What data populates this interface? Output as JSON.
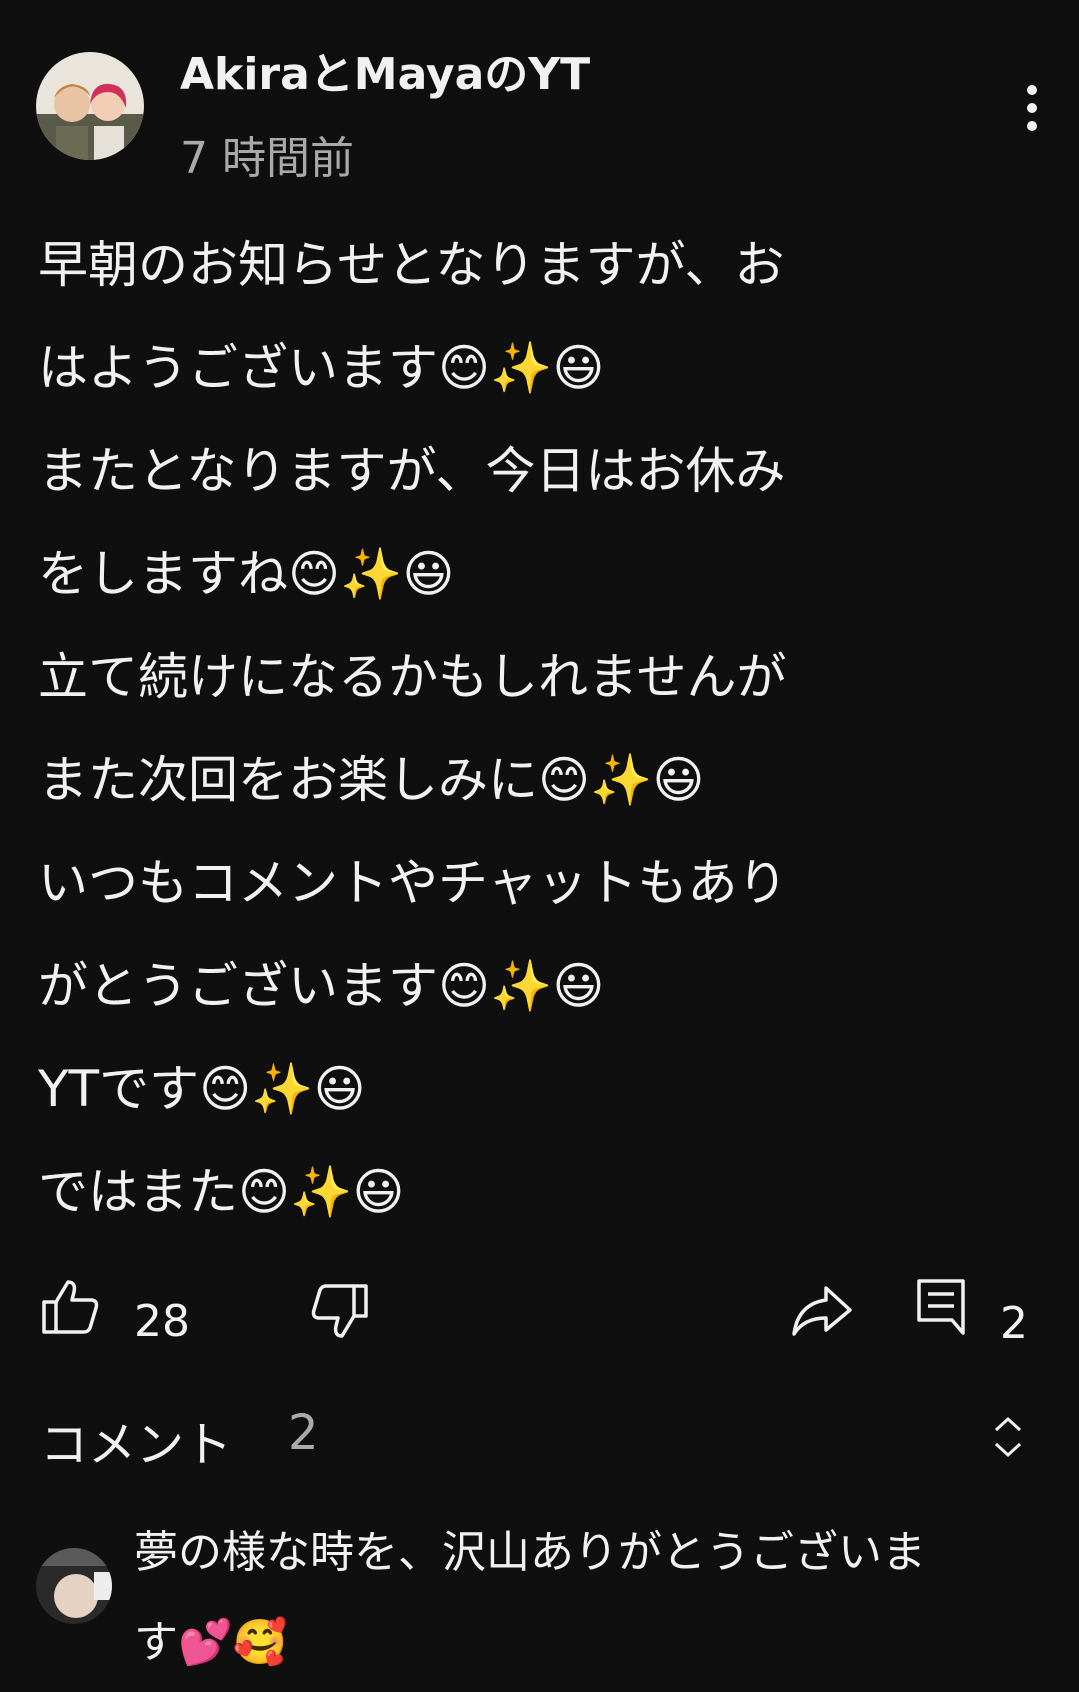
{
  "post": {
    "channel_name": "AkiraとMayaのYT",
    "time": "7 時間前",
    "lines": [
      "早朝のお知らせとなりますが、お",
      "はようございます😊✨😃",
      "またとなりますが、今日はお休み",
      "をしますね😊✨😃",
      "立て続けになるかもしれませんが",
      "また次回をお楽しみに😊✨😃",
      "いつもコメントやチャットもあり",
      "がとうございます😊✨😃",
      "YTです😊✨😃",
      "ではまた😊✨😃"
    ]
  },
  "actions": {
    "like_count": "28",
    "comment_count": "2"
  },
  "comments_section": {
    "title": "コメント",
    "count": "2"
  },
  "top_comment": {
    "lines": [
      "夢の様な時を、沢山ありがとうございま",
      "す💕🥰"
    ]
  },
  "icons": {
    "avatar": "avatar-image",
    "more": "more-vert-icon",
    "like": "thumbs-up-icon",
    "dislike": "thumbs-down-icon",
    "share": "share-icon",
    "comment": "comment-icon",
    "expand": "unfold-icon"
  },
  "colors": {
    "background": "#0f0f0f",
    "text": "#f1f1f1",
    "secondary_text": "#aaaaaa"
  }
}
